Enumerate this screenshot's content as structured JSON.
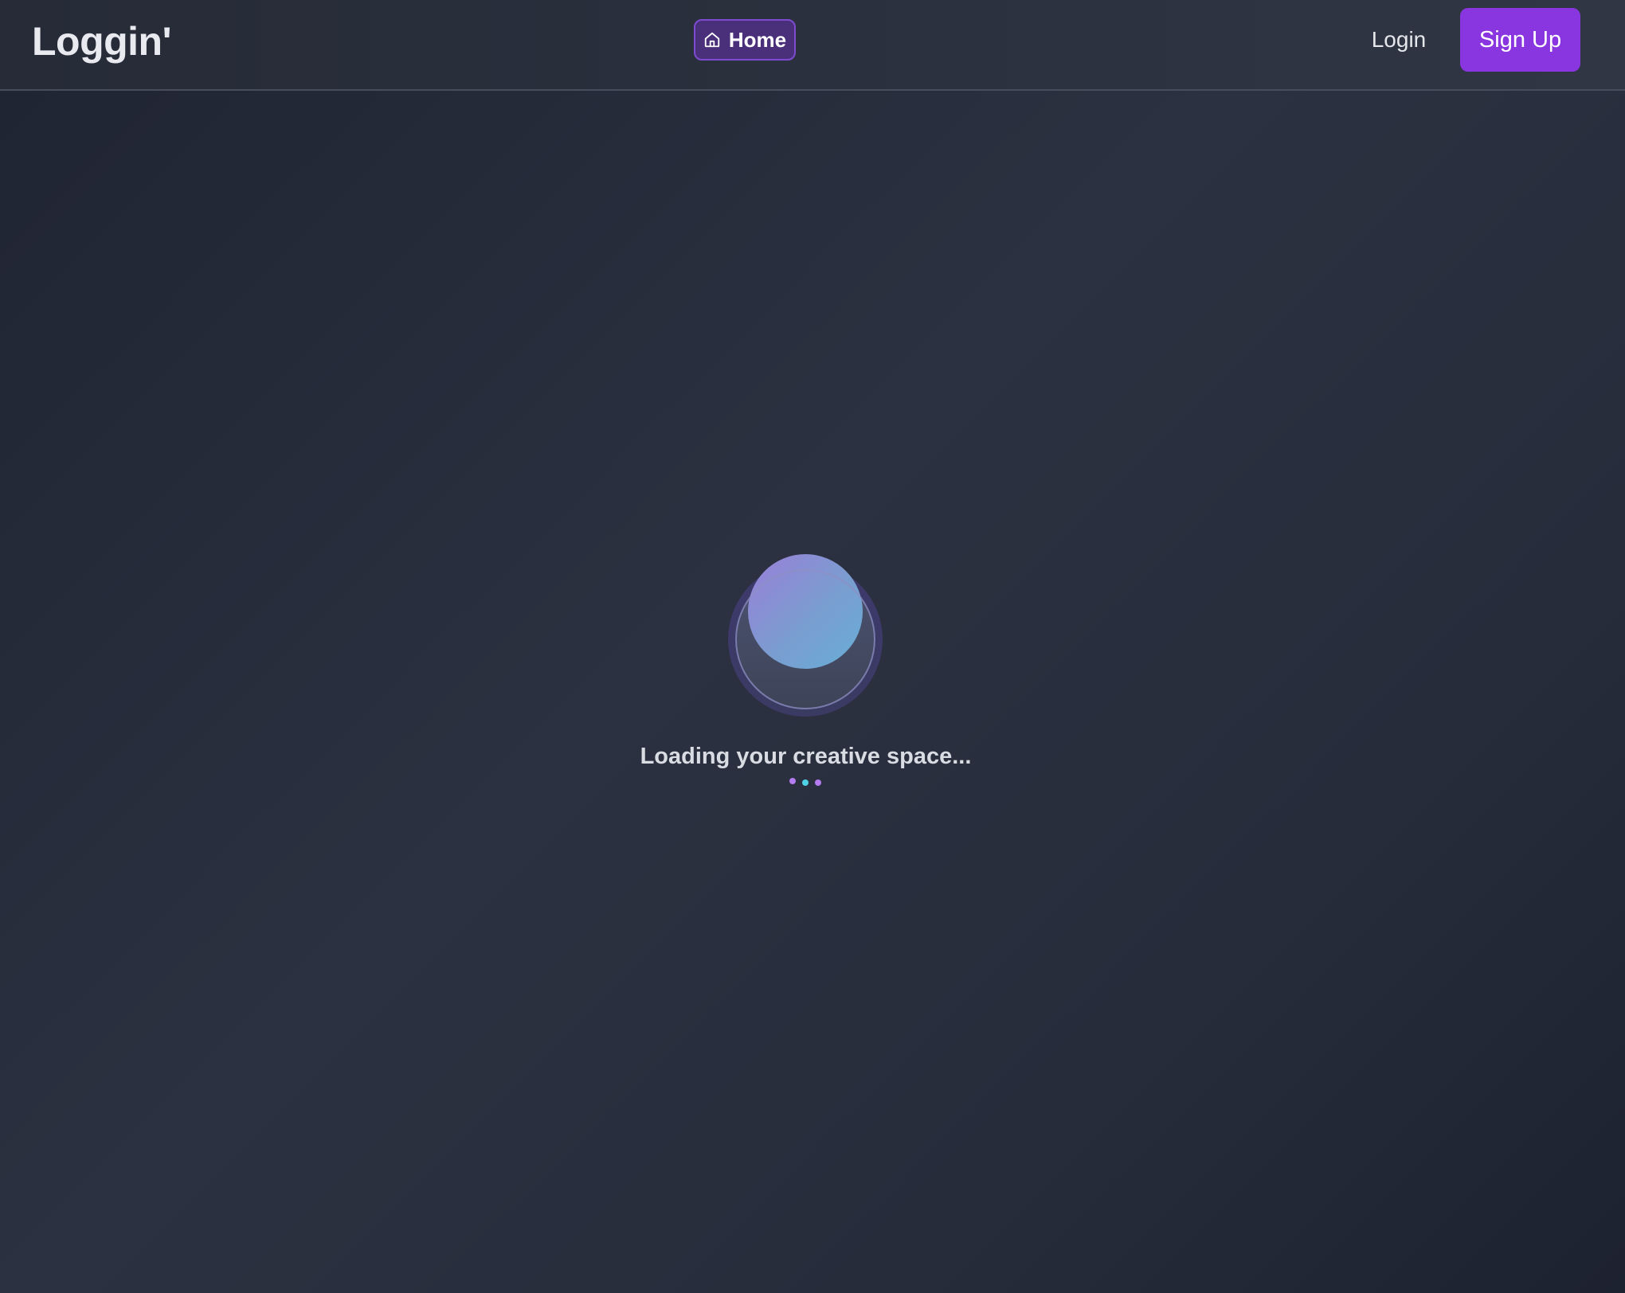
{
  "navbar": {
    "brand": "Loggin'",
    "home_label": "Home",
    "home_icon": "home-icon",
    "login_label": "Login",
    "signup_label": "Sign Up"
  },
  "loading": {
    "message": "Loading your creative space...",
    "dot_colors": [
      "#b57bf0",
      "#4fd1e6",
      "#b57bf0"
    ]
  },
  "colors": {
    "accent": "#8a36e0",
    "home_pill_bg": "#4a2f7a",
    "home_pill_border": "#7e4bd0"
  }
}
